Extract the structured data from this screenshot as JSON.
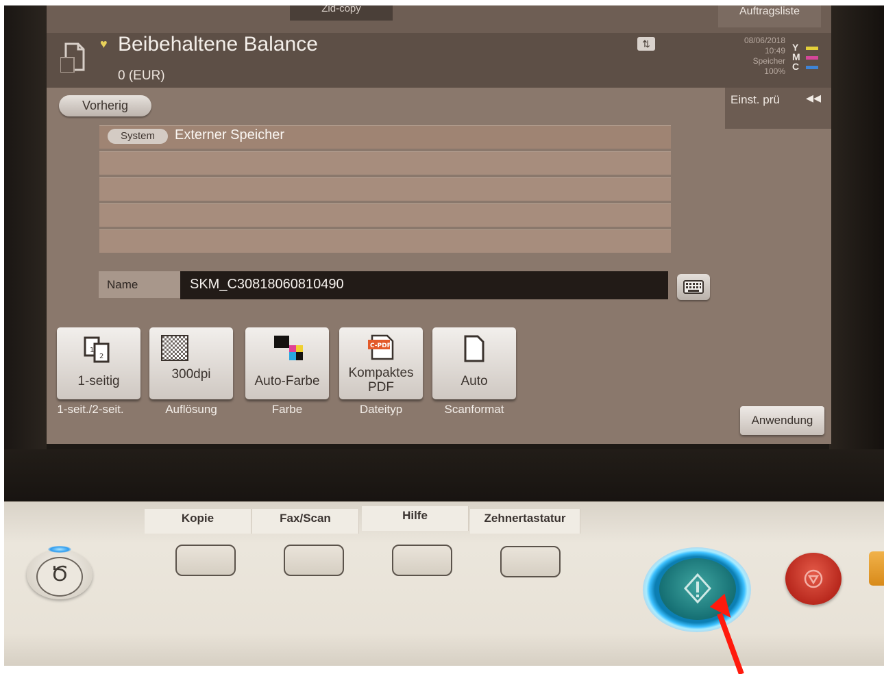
{
  "top_tabs": {
    "left": "Zid-copy",
    "right": "Auftragsliste"
  },
  "header": {
    "title": "Beibehaltene Balance",
    "balance": "0 (EUR)",
    "icons": [
      "document-icon",
      "bulb-icon",
      "transfer-icon"
    ]
  },
  "status": {
    "date": "08/06/2018",
    "time": "10:49",
    "memory_label": "Speicher",
    "memory_value": "100%",
    "toner": [
      {
        "letter": "Y",
        "color": "#e3cf3a"
      },
      {
        "letter": "M",
        "color": "#d5479a"
      },
      {
        "letter": "C",
        "color": "#3f84d6"
      }
    ],
    "settings_check": "Einst. prü"
  },
  "nav": {
    "back": "Vorherig"
  },
  "list": {
    "badge": "System",
    "first_row": "Externer Speicher",
    "empty_rows": 4
  },
  "name_field": {
    "label": "Name",
    "value": "SKM_C30818060810490"
  },
  "tiles": [
    {
      "text": "1-seitig",
      "caption": "1-seit./2-seit.",
      "icon": "duplex-icon"
    },
    {
      "text": "300dpi",
      "caption": "Auflösung",
      "icon": "resolution-icon"
    },
    {
      "text": "Auto-Farbe",
      "caption": "Farbe",
      "icon": "color-icon"
    },
    {
      "text_line1": "Kompaktes",
      "text_line2": "PDF",
      "caption": "Dateityp",
      "icon": "pdf-icon",
      "icon_badge": "C-PDF"
    },
    {
      "text": "Auto",
      "caption": "Scanformat",
      "icon": "page-icon"
    }
  ],
  "apply_button": "Anwendung",
  "hard_keys": [
    "Kopie",
    "Fax/Scan",
    "Hilfe",
    "Zehnertastatur"
  ],
  "colors": {
    "accent_start_glow": "#3cc0ff",
    "start_button": "#156f73",
    "stop_button": "#b8281d",
    "annotation_arrow": "#ff1a0d"
  }
}
